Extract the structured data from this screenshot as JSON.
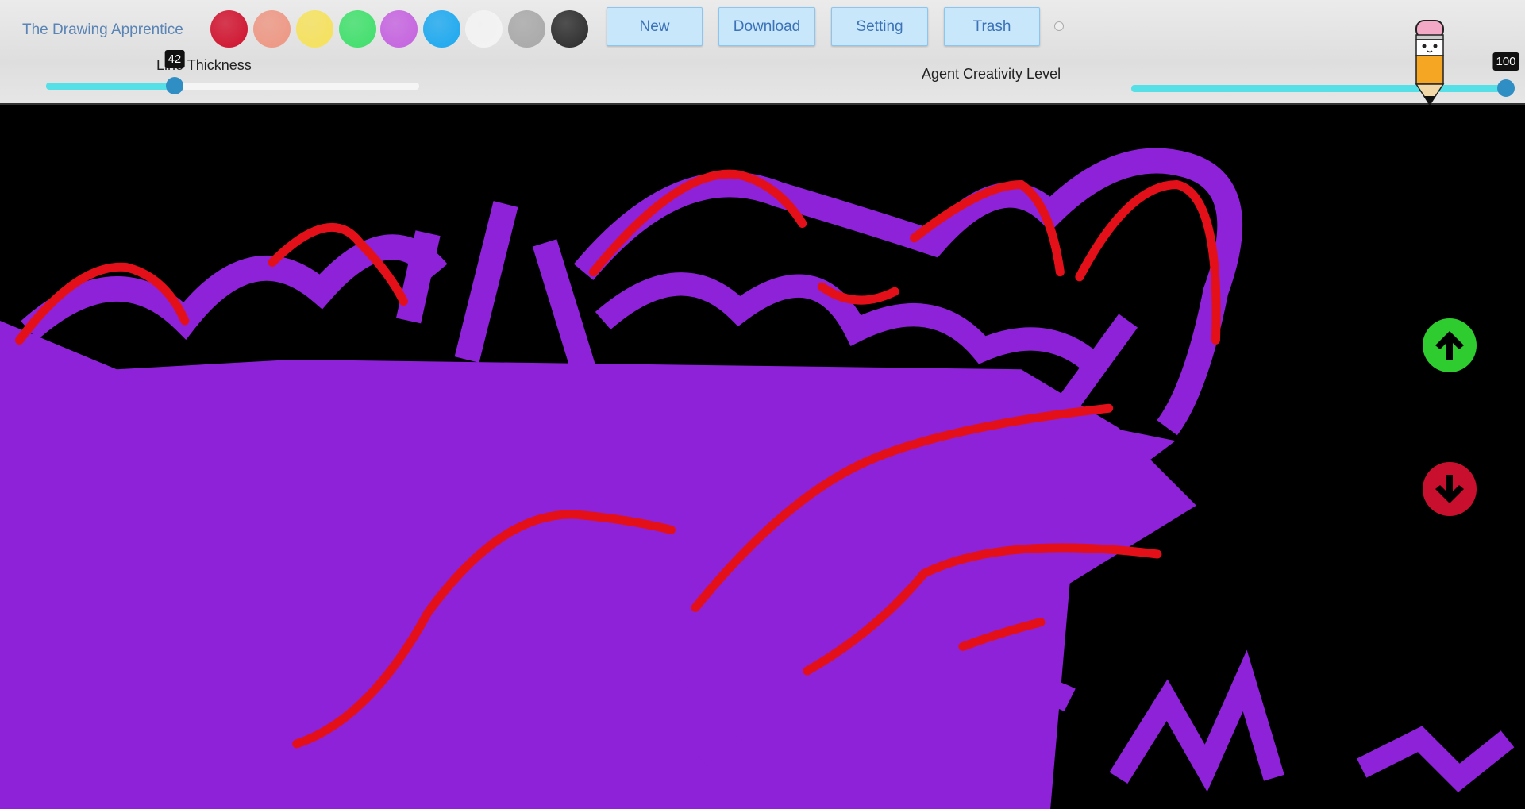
{
  "app": {
    "title": "The Drawing Apprentice"
  },
  "palette": [
    {
      "name": "red",
      "color": "#d0102c"
    },
    {
      "name": "salmon",
      "color": "#ee9682"
    },
    {
      "name": "yellow",
      "color": "#f6e25a"
    },
    {
      "name": "green",
      "color": "#3ee06a"
    },
    {
      "name": "purple",
      "color": "#c561e0"
    },
    {
      "name": "blue",
      "color": "#1aa8f0"
    },
    {
      "name": "white",
      "color": "#f4f4f4"
    },
    {
      "name": "gray",
      "color": "#a8a8a8"
    },
    {
      "name": "black",
      "color": "#2a2a2a"
    }
  ],
  "toolbar": {
    "new_label": "New",
    "download_label": "Download",
    "setting_label": "Setting",
    "trash_label": "Trash"
  },
  "line_thickness": {
    "label": "Line Thickness",
    "value": "42",
    "percent": 42
  },
  "creativity": {
    "label": "Agent Creativity Level",
    "value": "100",
    "percent": 100
  },
  "canvas": {
    "background": "#000000",
    "user_stroke_color": "#8e22d8",
    "agent_stroke_color": "#e3101a"
  },
  "controls": {
    "up_color": "#2ecc2e",
    "down_color": "#c8102e"
  }
}
